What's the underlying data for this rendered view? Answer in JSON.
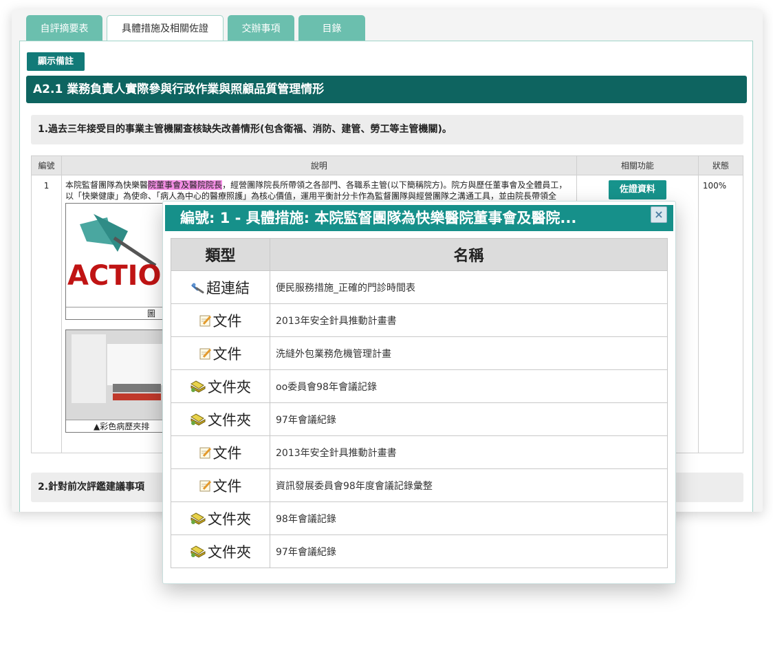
{
  "tabs": [
    {
      "label": "自評摘要表"
    },
    {
      "label": "具體措施及相關佐證"
    },
    {
      "label": "交辦事項"
    },
    {
      "label": "目錄"
    }
  ],
  "note_button": "顯示備註",
  "section_title": "A2.1 業務負責人實際參與行政作業與照顧品質管理情形",
  "question1": "1.過去三年接受目的事業主管機關查核缺失改善情形(包含衛福、消防、建管、勞工等主管機關)。",
  "question2": "2.針對前次評鑑建議事項",
  "table": {
    "headers": {
      "no": "編號",
      "desc": "說明",
      "func": "相關功能",
      "status": "狀態"
    },
    "row": {
      "no": "1",
      "desc_pre": "本院監督團隊為快樂醫",
      "desc_hl": "院董事會及醫院院長",
      "desc_post": "，經營團隊院長所帶領之各部門、各職系主管(以下簡稱院方)。院方與歷任董事會及全體員工，以「快樂健康」為使命、「病人為中心的醫療照護」為核心價值，運用平衡計分卡作為監督團隊與經營團隊之溝通工具，並由院長帶領全",
      "evidence_button": "佐證資料",
      "status": "100%",
      "image1_text": "ACTIO",
      "image1_caption": "圖",
      "image2_caption": "▲彩色病歷夾排"
    }
  },
  "modal": {
    "title": "編號: 1 - 具體措施: 本院監督團隊為快樂醫院董事會及醫院...",
    "close": "×",
    "headers": {
      "type": "類型",
      "name": "名稱"
    },
    "rows": [
      {
        "type": "超連結",
        "icon": "link-icon",
        "name": "便民服務措施_正確的門診時間表"
      },
      {
        "type": "文件",
        "icon": "document-icon",
        "name": "2013年安全針具推動計畫書"
      },
      {
        "type": "文件",
        "icon": "document-icon",
        "name": "洗縫外包業務危機管理計畫"
      },
      {
        "type": "文件夾",
        "icon": "folder-icon",
        "name": "oo委員會98年會議記錄"
      },
      {
        "type": "文件夾",
        "icon": "folder-icon",
        "name": "97年會議紀錄"
      },
      {
        "type": "文件",
        "icon": "document-icon",
        "name": "2013年安全針具推動計畫書"
      },
      {
        "type": "文件",
        "icon": "document-icon",
        "name": "資訊發展委員會98年度會議記錄彙整"
      },
      {
        "type": "文件夾",
        "icon": "folder-icon",
        "name": "98年會議記錄"
      },
      {
        "type": "文件夾",
        "icon": "folder-icon",
        "name": "97年會議紀錄"
      }
    ]
  },
  "colors": {
    "accent_dark": "#0e6460",
    "accent": "#16908a",
    "tab": "#6bbfae",
    "highlight": "#f58ee6"
  }
}
